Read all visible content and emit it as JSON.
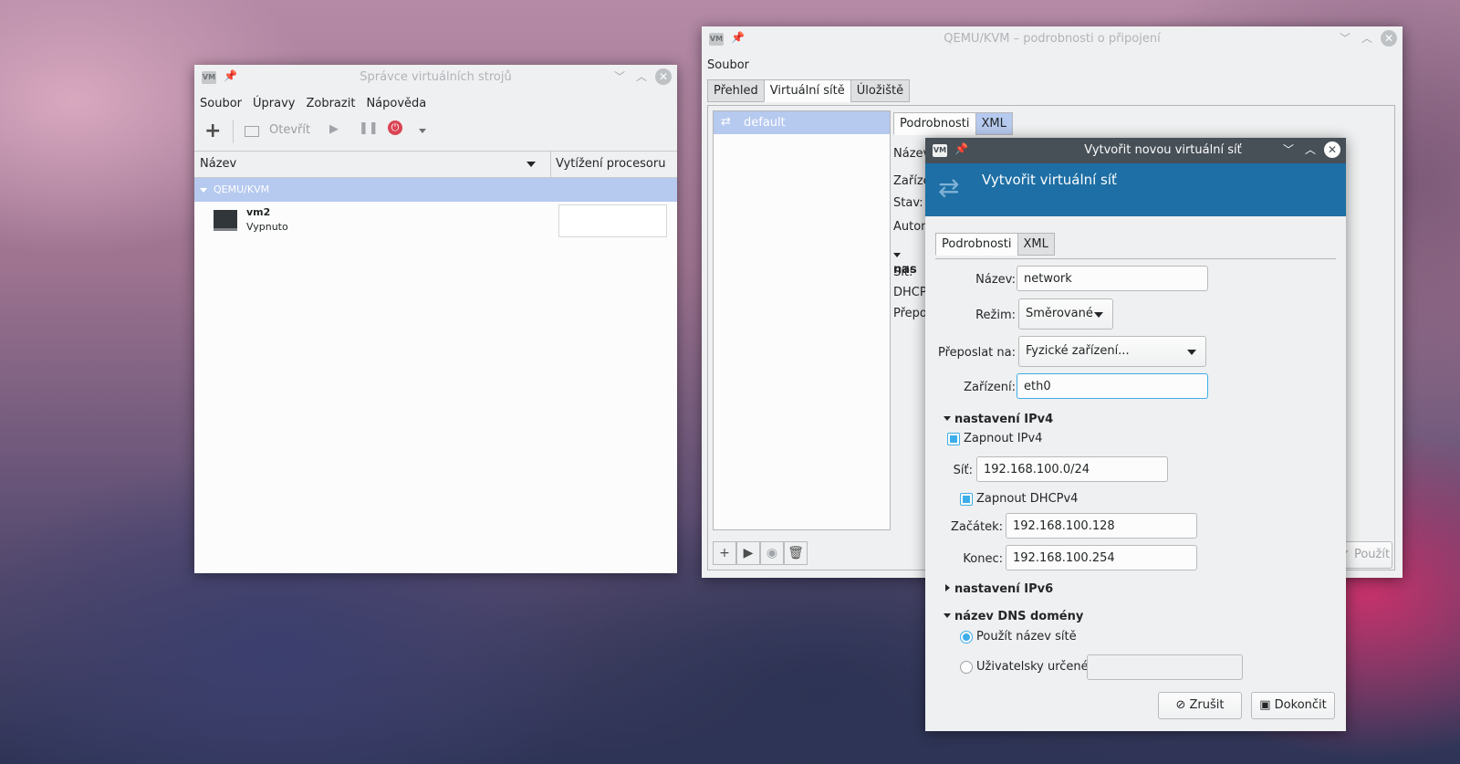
{
  "win1": {
    "title": "Správce virtuálních strojů",
    "logo": "VM",
    "menu": [
      "Soubor",
      "Úpravy",
      "Zobrazit",
      "Nápověda"
    ],
    "toolbar": {
      "new_icon": "+",
      "open_label": "Otevřít"
    },
    "columns": {
      "name": "Název",
      "cpu": "Vytížení procesoru"
    },
    "group": "QEMU/KVM",
    "vm": {
      "name": "vm2",
      "status": "Vypnuto"
    }
  },
  "win2": {
    "title": "QEMU/KVM – podrobnosti o připojení",
    "logo": "VM",
    "menu": [
      "Soubor"
    ],
    "tabs": [
      "Přehled",
      "Virtuální sítě",
      "Úložiště"
    ],
    "network_item": "default",
    "subtabs": [
      "Podrobnosti",
      "XML"
    ],
    "labels": [
      "Název",
      "Zaříze",
      "Stav:",
      "Autom",
      "nas",
      "Síť:",
      "DHCP",
      "Přepo"
    ],
    "apply": "Použít"
  },
  "dialog": {
    "title": "Vytvořit novou virtuální síť",
    "logo": "VM",
    "header": "Vytvořit virtuální síť",
    "tabs": [
      "Podrobnosti",
      "XML"
    ],
    "name_label": "Název:",
    "name_value": "network",
    "mode_label": "Režim:",
    "mode_value": "Směrované",
    "forward_label": "Přeposlat na:",
    "forward_value": "Fyzické zařízení...",
    "device_label": "Zařízení:",
    "device_value": "eth0",
    "ipv4_section": "nastavení IPv4",
    "enable_ipv4": "Zapnout IPv4",
    "net_label": "Síť:",
    "net_value": "192.168.100.0/24",
    "enable_dhcp": "Zapnout DHCPv4",
    "start_label": "Začátek:",
    "start_value": "192.168.100.128",
    "end_label": "Konec:",
    "end_value": "192.168.100.254",
    "ipv6_section": "nastavení IPv6",
    "dns_section": "název DNS domény",
    "dns_use_net": "Použít název sítě",
    "dns_custom": "Uživatelsky určené",
    "cancel": "Zrušit",
    "finish": "Dokončit"
  },
  "colors": {
    "accent": "#3daee9",
    "header_blue": "#1d6fa5",
    "title_dark": "#475057",
    "selection": "#b6c9ef"
  }
}
